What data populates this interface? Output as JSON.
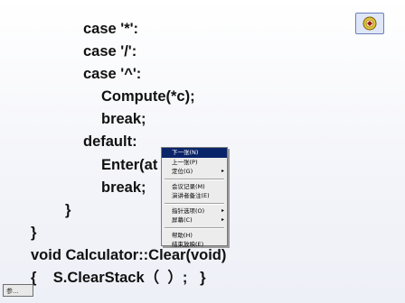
{
  "code_lines": [
    "case '*':",
    "case '/':",
    "case '^':",
    "Compute(*c);",
    "break;",
    "default:",
    "Enter(at",
    "break;",
    "}",
    "}",
    "void Calculator::Clear(void)",
    "{    S.ClearStack（  ）;   }"
  ],
  "context_menu": {
    "items": [
      {
        "label": "下一张(N)",
        "has_submenu": false,
        "selected": true
      },
      {
        "label": "上一张(P)",
        "has_submenu": false,
        "selected": false
      },
      {
        "label": "定位(G)",
        "has_submenu": true,
        "selected": false
      },
      {
        "label": "会议记录(M)",
        "has_submenu": false,
        "selected": false
      },
      {
        "label": "演讲者备注(E)",
        "has_submenu": false,
        "selected": false
      },
      {
        "label": "指针选项(O)",
        "has_submenu": true,
        "selected": false
      },
      {
        "label": "屏幕(C)",
        "has_submenu": true,
        "selected": false
      },
      {
        "label": "帮助(H)",
        "has_submenu": false,
        "selected": false
      },
      {
        "label": "结束放映(E)",
        "has_submenu": false,
        "selected": false
      }
    ],
    "submenu_arrow": "▸"
  },
  "pager": {
    "label": "参..."
  },
  "logo": {
    "icon": "school-emblem-icon",
    "color": "#c9a200"
  },
  "colors": {
    "menu_highlight": "#0a246a",
    "text": "#111111"
  }
}
